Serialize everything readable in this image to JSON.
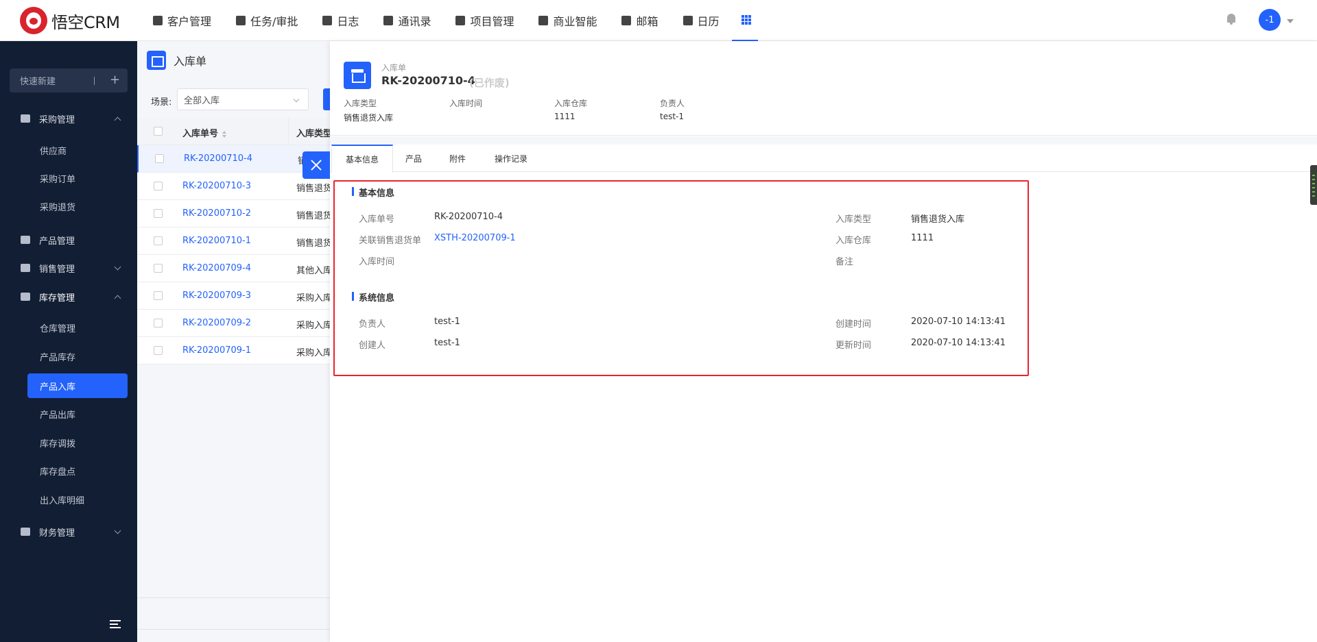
{
  "logo": {
    "text": "悟空CRM"
  },
  "topnav": {
    "items": [
      {
        "label": "客户管理",
        "icon": "document-icon"
      },
      {
        "label": "任务/审批",
        "icon": "briefcase-icon"
      },
      {
        "label": "日志",
        "icon": "log-icon"
      },
      {
        "label": "通讯录",
        "icon": "contacts-icon"
      },
      {
        "label": "项目管理",
        "icon": "project-icon"
      },
      {
        "label": "商业智能",
        "icon": "bi-icon"
      },
      {
        "label": "邮箱",
        "icon": "mail-icon"
      },
      {
        "label": "日历",
        "icon": "calendar-icon"
      }
    ],
    "avatar_text": "-1"
  },
  "sidebar": {
    "quick_new": "快速新建",
    "groups": [
      {
        "label": "采购管理",
        "icon": "cart-icon",
        "expanded": true,
        "items": [
          "供应商",
          "采购订单",
          "采购退货"
        ]
      },
      {
        "label": "产品管理",
        "icon": "cube-icon",
        "expanded": false,
        "items": []
      },
      {
        "label": "销售管理",
        "icon": "tag-icon",
        "expanded": false,
        "items": []
      },
      {
        "label": "库存管理",
        "icon": "archive-icon",
        "expanded": true,
        "items": [
          "仓库管理",
          "产品库存",
          "产品入库",
          "产品出库",
          "库存调拨",
          "库存盘点",
          "出入库明细"
        ]
      },
      {
        "label": "财务管理",
        "icon": "wallet-icon",
        "expanded": false,
        "items": []
      }
    ],
    "active_item": "产品入库"
  },
  "list": {
    "title": "入库单",
    "scene_label": "场景:",
    "scene_value": "全部入库",
    "columns": [
      "入库单号",
      "入库类型"
    ],
    "rows": [
      {
        "no": "RK-20200710-4",
        "type": "销售退货入库"
      },
      {
        "no": "RK-20200710-3",
        "type": "销售退货入库"
      },
      {
        "no": "RK-20200710-2",
        "type": "销售退货入库"
      },
      {
        "no": "RK-20200710-1",
        "type": "销售退货入库"
      },
      {
        "no": "RK-20200709-4",
        "type": "其他入库"
      },
      {
        "no": "RK-20200709-3",
        "type": "采购入库"
      },
      {
        "no": "RK-20200709-2",
        "type": "采购入库"
      },
      {
        "no": "RK-20200709-1",
        "type": "采购入库"
      }
    ]
  },
  "detail": {
    "type_label": "入库单",
    "title": "RK-20200710-4",
    "status": "(已作废)",
    "meta": [
      {
        "label": "入库类型",
        "value": "销售退货入库"
      },
      {
        "label": "入库时间",
        "value": ""
      },
      {
        "label": "入库仓库",
        "value": "1111"
      },
      {
        "label": "负责人",
        "value": "test-1"
      }
    ],
    "tabs": [
      "基本信息",
      "产品",
      "附件",
      "操作记录"
    ],
    "basic_title": "基本信息",
    "basic_fields": {
      "no_label": "入库单号",
      "no_value": "RK-20200710-4",
      "type_label": "入库类型",
      "type_value": "销售退货入库",
      "related_label": "关联销售退货单",
      "related_value": "XSTH-20200709-1",
      "warehouse_label": "入库仓库",
      "warehouse_value": "1111",
      "time_label": "入库时间",
      "time_value": "",
      "remark_label": "备注",
      "remark_value": ""
    },
    "system_title": "系统信息",
    "system_fields": {
      "owner_label": "负责人",
      "owner_value": "test-1",
      "created_time_label": "创建时间",
      "created_time_value": "2020-07-10 14:13:41",
      "creator_label": "创建人",
      "creator_value": "test-1",
      "updated_time_label": "更新时间",
      "updated_time_value": "2020-07-10 14:13:41"
    }
  },
  "colors": {
    "accent": "#2362fb",
    "sidebar_bg": "#121e33",
    "highlight_border": "#e8232e"
  }
}
